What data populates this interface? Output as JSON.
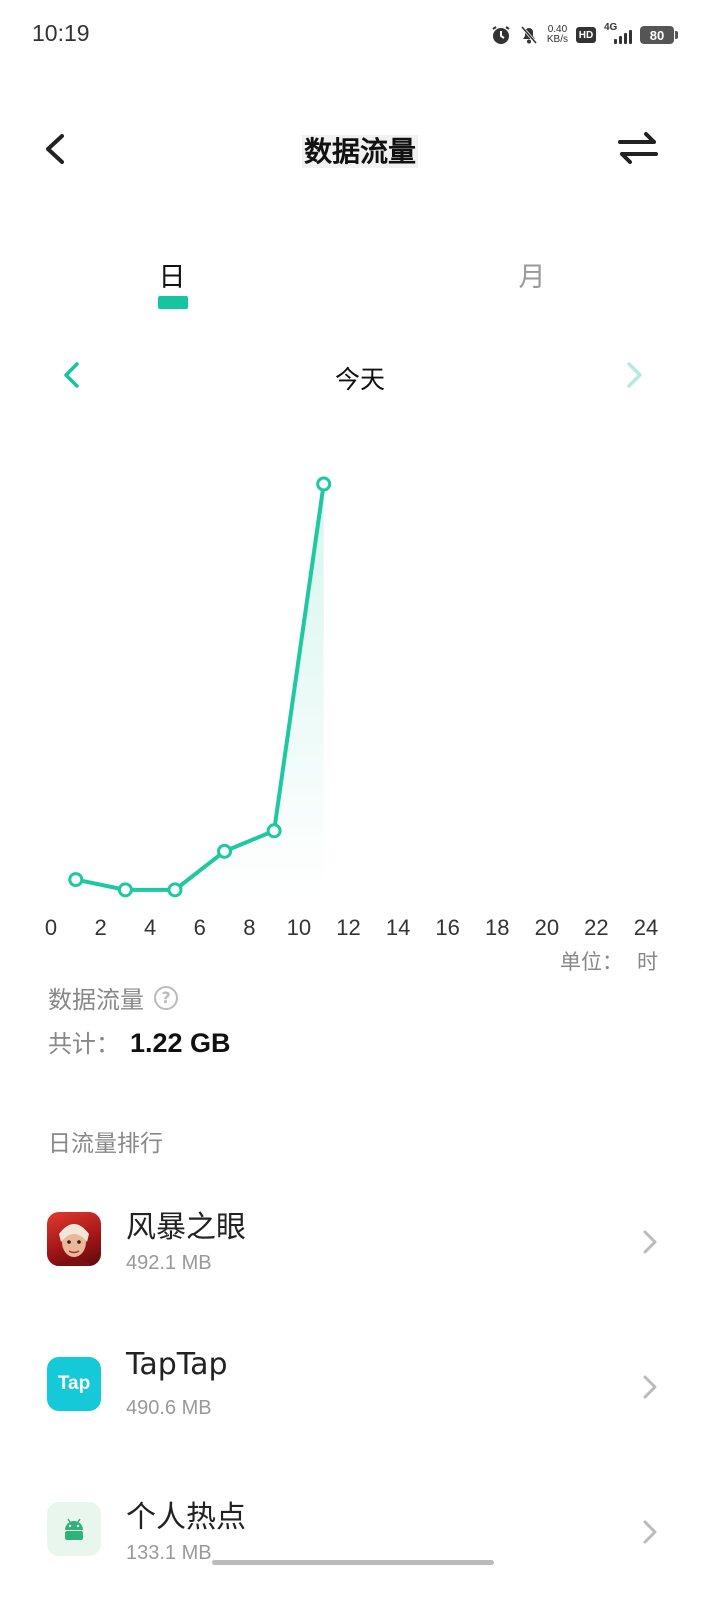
{
  "status_bar": {
    "time": "10:19",
    "net_speed_value": "0.40",
    "net_speed_unit": "KB/s",
    "hd_label": "HD",
    "network_type": "4G",
    "battery_level": "80"
  },
  "header": {
    "title": "数据流量"
  },
  "tabs": {
    "day_label": "日",
    "month_label": "月",
    "active": "day"
  },
  "date_nav": {
    "label": "今天"
  },
  "chart_data": {
    "type": "line",
    "title": "",
    "xlabel": "",
    "ylabel": "",
    "x_ticks": [
      "0",
      "2",
      "4",
      "6",
      "8",
      "10",
      "12",
      "14",
      "16",
      "18",
      "20",
      "22",
      "24"
    ],
    "xlim": [
      0,
      24
    ],
    "x": [
      1,
      3,
      5,
      7,
      9,
      11
    ],
    "values": [
      6,
      2,
      2,
      17,
      25,
      160
    ],
    "unit_label": "单位：",
    "unit_value": "时",
    "line_color": "#1ec8a0"
  },
  "summary": {
    "title": "数据流量",
    "total_label": "共计：",
    "total_value": "1.22 GB"
  },
  "ranking": {
    "title": "日流量排行",
    "apps": [
      {
        "name": "风暴之眼",
        "size": "492.1 MB",
        "icon": "game-app-icon"
      },
      {
        "name": "TapTap",
        "size": "490.6 MB",
        "icon": "taptap-icon"
      },
      {
        "name": "个人热点",
        "size": "133.1 MB",
        "icon": "android-icon"
      }
    ],
    "taptap_icon_text": "Tap"
  },
  "colors": {
    "accent": "#14c5a0",
    "text_secondary": "#888888"
  }
}
